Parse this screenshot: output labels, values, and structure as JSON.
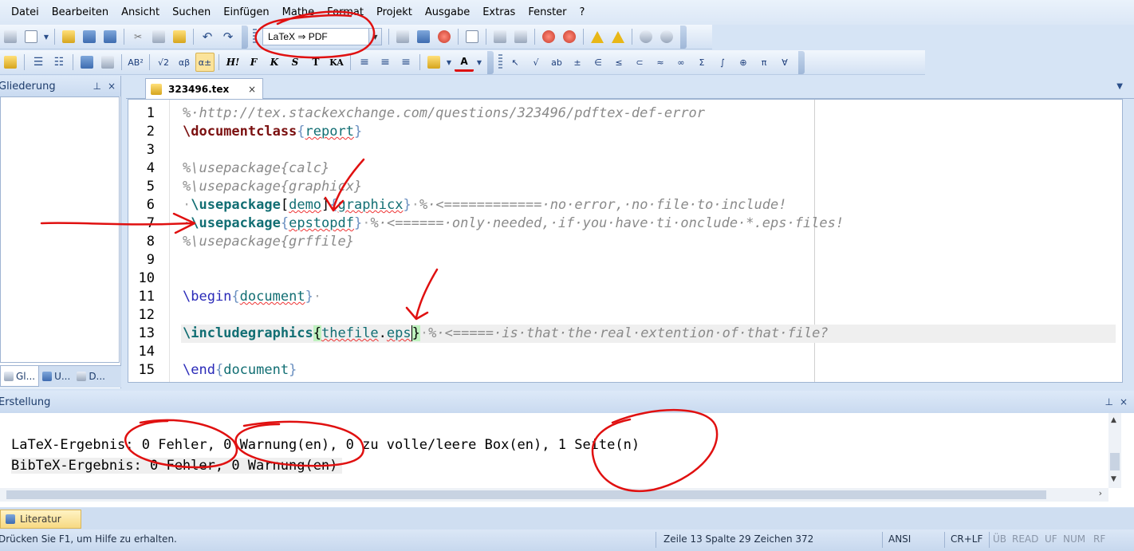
{
  "menu": [
    "Datei",
    "Bearbeiten",
    "Ansicht",
    "Suchen",
    "Einfügen",
    "Mathe",
    "Format",
    "Projekt",
    "Ausgabe",
    "Extras",
    "Fenster",
    "?"
  ],
  "toolbar1": {
    "profile_value": "LaTeX ⇒ PDF",
    "icons_left": [
      "project-icon",
      "new-file-icon",
      "open-icon",
      "save-icon",
      "save-all-icon",
      "cut-icon",
      "copy-icon",
      "paste-icon",
      "undo-icon",
      "redo-icon"
    ],
    "icons_right": [
      "build-icon",
      "build-view-icon",
      "stop-build-icon",
      "view-output-icon",
      "build-current-icon",
      "build-bibtex-icon",
      "forward-search-icon",
      "inverse-search-icon",
      "warning-next-icon",
      "warning-prev-icon",
      "help-icon",
      "help-search-icon"
    ]
  },
  "toolbar2": {
    "format_buttons": [
      "H!",
      "F",
      "K",
      "S",
      "T",
      "KA"
    ],
    "math_symbols": [
      "↖",
      "√",
      "ab",
      "±",
      "∈",
      "≤",
      "⊂",
      "≈",
      "∞",
      "Σ",
      "∫",
      "⊕",
      "π",
      "∀"
    ]
  },
  "left_panel": {
    "title": "Gliederung",
    "tabs": [
      "Gl...",
      "U...",
      "D..."
    ]
  },
  "doc_tab": {
    "filename": "323496.tex",
    "close": "×"
  },
  "editor": {
    "line_numbers": [
      "1",
      "2",
      "3",
      "4",
      "5",
      "6",
      "7",
      "8",
      "9",
      "10",
      "11",
      "12",
      "13",
      "14",
      "15"
    ],
    "current_line": 13
  },
  "output": {
    "title": "Erstellung",
    "line1": "LaTeX-Ergebnis: 0 Fehler, 0 Warnung(en), 0 zu volle/leere Box(en), 1 Seite(n)",
    "line2": "BibTeX-Ergebnis: 0 Fehler, 0 Warnung(en)"
  },
  "bottom_tab": {
    "label": "Literatur"
  },
  "status": {
    "help": "Drücken Sie F1, um Hilfe zu erhalten.",
    "position": "Zeile 13 Spalte 29 Zeichen 372",
    "encoding": "ANSI",
    "line_ending": "CR+LF",
    "indicators": [
      "ÜB",
      "READ",
      "UF",
      "NUM",
      "RF"
    ]
  },
  "panel_controls": {
    "pin": "⊥",
    "close": "×"
  }
}
